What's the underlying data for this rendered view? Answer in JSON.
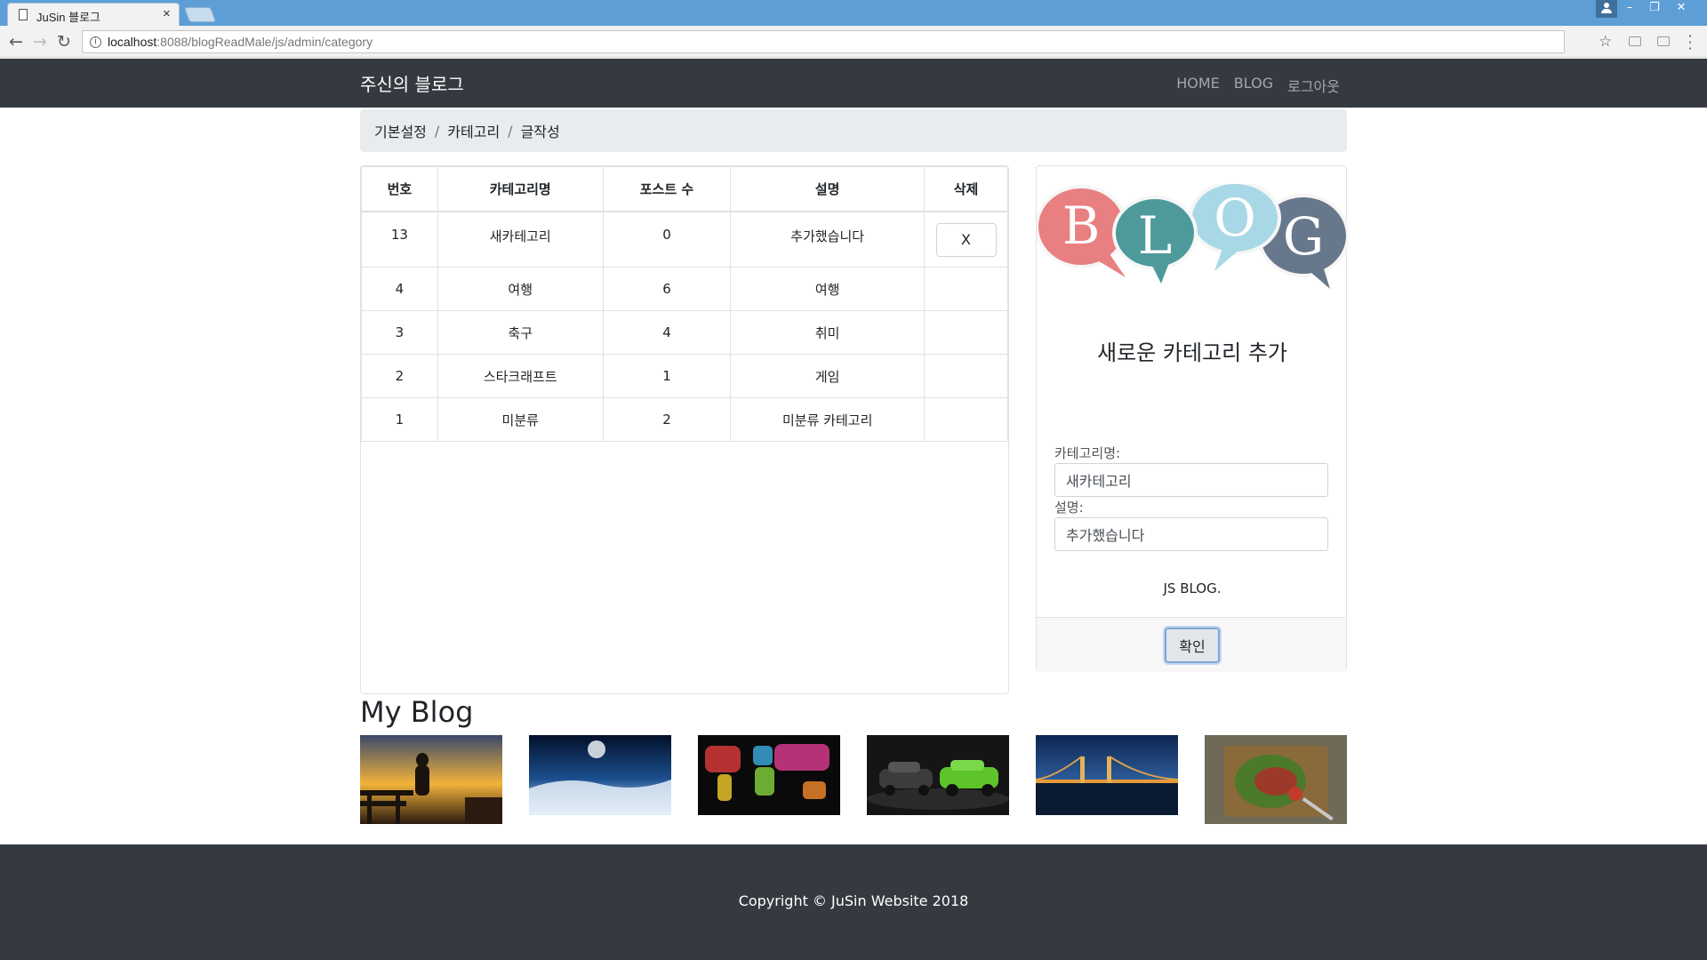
{
  "browser": {
    "tab_title": "JuSin 블로그",
    "tab_close": "×",
    "url_host": "localhost",
    "url_rest": ":8088/blogReadMale/js/admin/category",
    "icons": {
      "page": "document-icon",
      "back": "back-arrow-icon",
      "forward": "forward-arrow-icon",
      "reload": "reload-icon",
      "info": "info-icon",
      "bookmark": "star-icon",
      "menu": "vertical-dots-icon",
      "user": "user-icon",
      "minimize": "minimize-icon",
      "restore": "restore-icon",
      "close": "close-icon"
    }
  },
  "navbar": {
    "brand": "주신의 블로그",
    "links": [
      "HOME",
      "BLOG",
      "로그아웃"
    ]
  },
  "breadcrumb": {
    "items": [
      "기본설정",
      "카테고리",
      "글작성"
    ],
    "separator": "/"
  },
  "category_table": {
    "headers": [
      "번호",
      "카테고리명",
      "포스트 수",
      "설명",
      "삭제"
    ],
    "rows": [
      {
        "no": "13",
        "name": "새카테고리",
        "posts": "0",
        "desc": "추가했습니다",
        "delete": "X"
      },
      {
        "no": "4",
        "name": "여행",
        "posts": "6",
        "desc": "여행"
      },
      {
        "no": "3",
        "name": "축구",
        "posts": "4",
        "desc": "취미"
      },
      {
        "no": "2",
        "name": "스타크래프트",
        "posts": "1",
        "desc": "게임"
      },
      {
        "no": "1",
        "name": "미분류",
        "posts": "2",
        "desc": "미분류 카테고리"
      }
    ]
  },
  "add_card": {
    "logo_letters": [
      "B",
      "L",
      "O",
      "G"
    ],
    "title": "새로운 카테고리 추가",
    "name_label": "카테고리명:",
    "name_value": "새카테고리",
    "desc_label": "설명:",
    "desc_value": "추가했습니다",
    "card_text": "JS BLOG.",
    "submit": "확인"
  },
  "gallery": {
    "title": "My Blog",
    "images": [
      "sunset-couple-photo",
      "earth-moon-photo",
      "world-map-words-photo",
      "sports-cars-photo",
      "night-bridge-photo",
      "steak-plate-photo"
    ]
  },
  "footer": {
    "copyright": "Copyright © JuSin Website 2018"
  }
}
